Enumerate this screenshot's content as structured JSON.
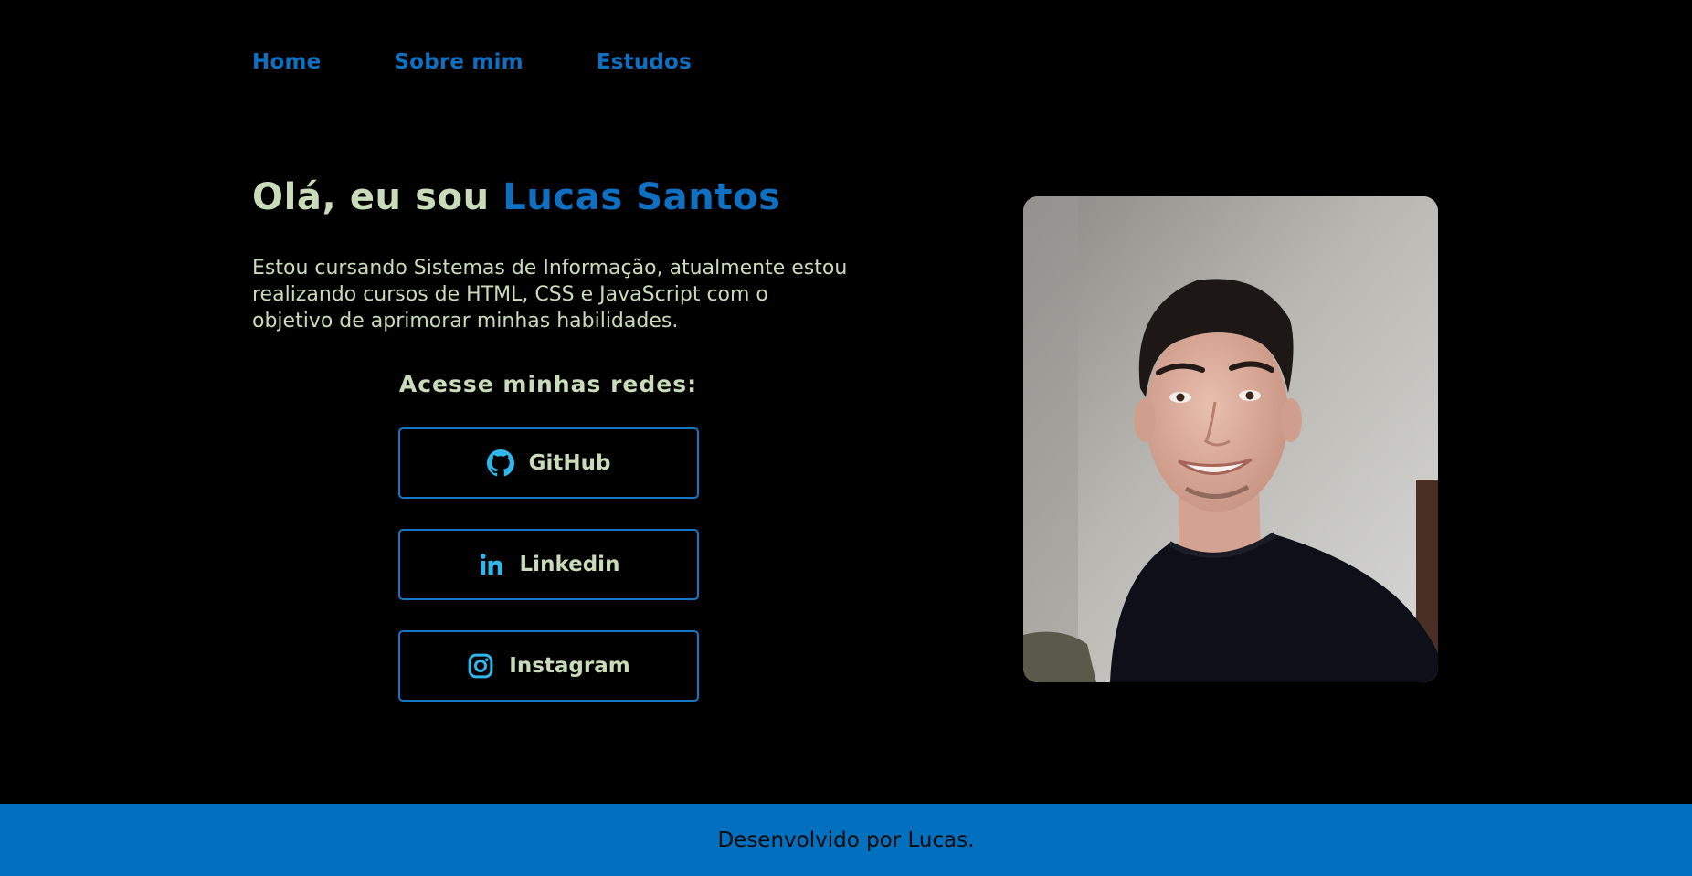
{
  "nav": {
    "items": [
      {
        "label": "Home"
      },
      {
        "label": "Sobre mim"
      },
      {
        "label": "Estudos"
      }
    ]
  },
  "hero": {
    "greeting": "Olá, eu sou ",
    "name": "Lucas Santos",
    "intro": "Estou cursando Sistemas de Informação, atualmente estou realizando cursos de HTML, CSS e JavaScript com o objetivo de aprimorar minhas habilidades."
  },
  "social": {
    "heading": "Acesse minhas redes:",
    "links": [
      {
        "label": "GitHub",
        "icon": "github-icon"
      },
      {
        "label": "Linkedin",
        "icon": "linkedin-icon"
      },
      {
        "label": "Instagram",
        "icon": "instagram-icon"
      }
    ]
  },
  "photo": {
    "subject": "profile-photo"
  },
  "footer": {
    "text": "Desenvolvido por Lucas."
  },
  "colors": {
    "background": "#000000",
    "accent": "#0f6fc0",
    "text": "#c8dcb9",
    "icon": "#2fb6ea",
    "footer": "#0070bf"
  }
}
